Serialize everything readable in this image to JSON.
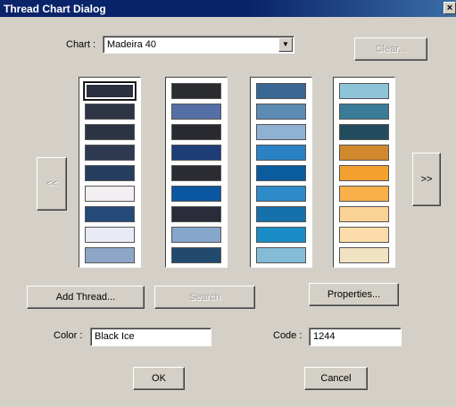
{
  "window": {
    "title": "Thread Chart Dialog",
    "close_glyph": "×"
  },
  "chart": {
    "label": "Chart :",
    "selected": "Madeira 40",
    "dropdown_icon": "chevron-down-icon"
  },
  "clear_button": "Clear...",
  "nav": {
    "prev": "<<",
    "next": ">>"
  },
  "columns": [
    {
      "swatches": [
        "#2a3040",
        "#2c3446",
        "#2a3442",
        "#2e3a52",
        "#263e5e",
        "#f2eef2",
        "#234a78",
        "#e8eaf6",
        "#8ea6c6"
      ]
    },
    {
      "swatches": [
        "#2a2c30",
        "#5470a6",
        "#282a30",
        "#1e3e78",
        "#2a2c32",
        "#0a56a0",
        "#2a2c3a",
        "#86a6cc",
        "#224a6e"
      ]
    },
    {
      "swatches": [
        "#3a6894",
        "#5c8cb4",
        "#8fb2d4",
        "#2a82c4",
        "#0a5c9e",
        "#2e8ac8",
        "#1670aa",
        "#1a8cc8",
        "#84bcd8"
      ]
    },
    {
      "swatches": [
        "#8ec4d8",
        "#3a7c98",
        "#224c5e",
        "#d2882c",
        "#f4a02e",
        "#fab04a",
        "#fbd296",
        "#fcdcaa",
        "#f0e2c2"
      ]
    }
  ],
  "selected_swatch": {
    "column": 0,
    "row": 0
  },
  "buttons": {
    "add_thread": "Add Thread...",
    "search": "Search",
    "properties": "Properties...",
    "ok": "OK",
    "cancel": "Cancel"
  },
  "color_field": {
    "label": "Color :",
    "value": "Black Ice"
  },
  "code_field": {
    "label": "Code :",
    "value": "1244"
  }
}
